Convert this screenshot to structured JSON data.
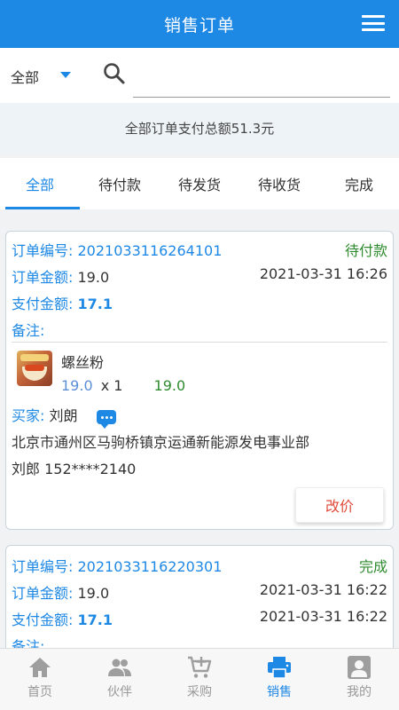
{
  "header": {
    "title": "销售订单"
  },
  "search": {
    "filter_value": "全部",
    "placeholder": ""
  },
  "summary": {
    "text": "全部订单支付总额51.3元"
  },
  "tabs": [
    {
      "label": "全部",
      "active": true
    },
    {
      "label": "待付款",
      "active": false
    },
    {
      "label": "待发货",
      "active": false
    },
    {
      "label": "待收货",
      "active": false
    },
    {
      "label": "完成",
      "active": false
    }
  ],
  "orders": [
    {
      "order_no_label": "订单编号:",
      "order_no": "2021033116264101",
      "status": "待付款",
      "amount_label": "订单金额:",
      "amount": "19.0",
      "date": "2021-03-31 16:26",
      "paid_label": "支付金额:",
      "paid": "17.1",
      "remark_label": "备注:",
      "product": {
        "name": "螺丝粉",
        "price": "19.0",
        "qty": "x 1",
        "subtotal": "19.0"
      },
      "buyer_label": "买家:",
      "buyer": "刘朗",
      "address": "北京市通州区马驹桥镇京运通新能源发电事业部",
      "contact": "刘郎  152****2140",
      "action_label": "改价"
    },
    {
      "order_no_label": "订单编号:",
      "order_no": "2021033116220301",
      "status": "完成",
      "amount_label": "订单金额:",
      "amount": "19.0",
      "date": "2021-03-31 16:22",
      "paid_label": "支付金额:",
      "paid": "17.1",
      "paid_date": "2021-03-31 16:22",
      "remark_label": "备注:"
    }
  ],
  "bottom_nav": [
    {
      "label": "首页",
      "icon": "home-icon",
      "active": false
    },
    {
      "label": "伙伴",
      "icon": "partners-icon",
      "active": false
    },
    {
      "label": "采购",
      "icon": "cart-add-icon",
      "active": false
    },
    {
      "label": "销售",
      "icon": "printer-icon",
      "active": true
    },
    {
      "label": "我的",
      "icon": "profile-icon",
      "active": false
    }
  ],
  "colors": {
    "primary": "#1e88e5",
    "status_green": "#2e8b2e",
    "action_red": "#e04a3a"
  }
}
